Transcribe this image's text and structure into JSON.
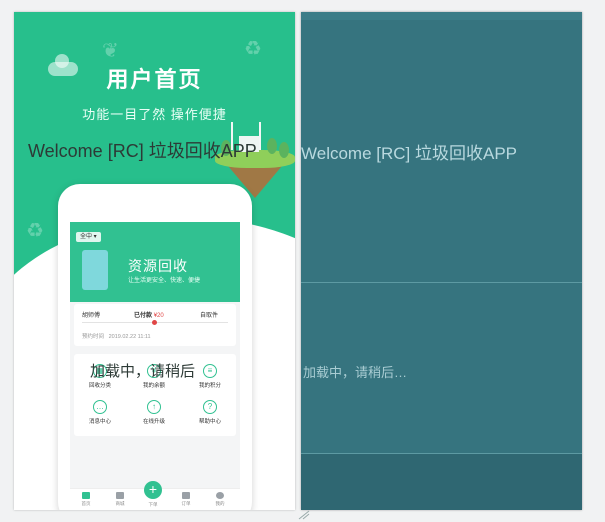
{
  "hero": {
    "title": "用户首页",
    "subtitle": "功能一目了然  操作便捷"
  },
  "app": {
    "city_tag": "全中 ▾",
    "promo": {
      "title": "资源回收",
      "subtitle": "让生活更安全、快速、便捷"
    },
    "order": {
      "collector": "胡师傅",
      "paid_label": "已付款",
      "paid_amount": "¥20",
      "status": "自取件",
      "time_label": "预约时间",
      "time_value": "2019.02.22  11:11"
    },
    "grid": [
      {
        "label": "回收分类",
        "icon": "recycle-category-icon"
      },
      {
        "label": "我的余额",
        "icon": "wallet-icon"
      },
      {
        "label": "我的积分",
        "icon": "points-icon"
      },
      {
        "label": "消息中心",
        "icon": "message-icon"
      },
      {
        "label": "在线升级",
        "icon": "upgrade-icon"
      },
      {
        "label": "帮助中心",
        "icon": "help-icon"
      }
    ],
    "tabs": [
      {
        "label": "首页",
        "icon": "home-icon"
      },
      {
        "label": "商城",
        "icon": "shop-icon"
      },
      {
        "label": "下单",
        "icon": "plus-icon"
      },
      {
        "label": "订单",
        "icon": "order-icon"
      },
      {
        "label": "我的",
        "icon": "user-icon"
      }
    ]
  },
  "overlay": {
    "welcome_left": "Welcome [RC] 垃圾回收APP",
    "loading_left": "加载中，请稍后",
    "welcome_right": "Welcome [RC] 垃圾回收APP",
    "loading_right": "加载中，请稍后…"
  },
  "colors": {
    "brand_green": "#27bf8c",
    "right_panel": "#36747f"
  }
}
